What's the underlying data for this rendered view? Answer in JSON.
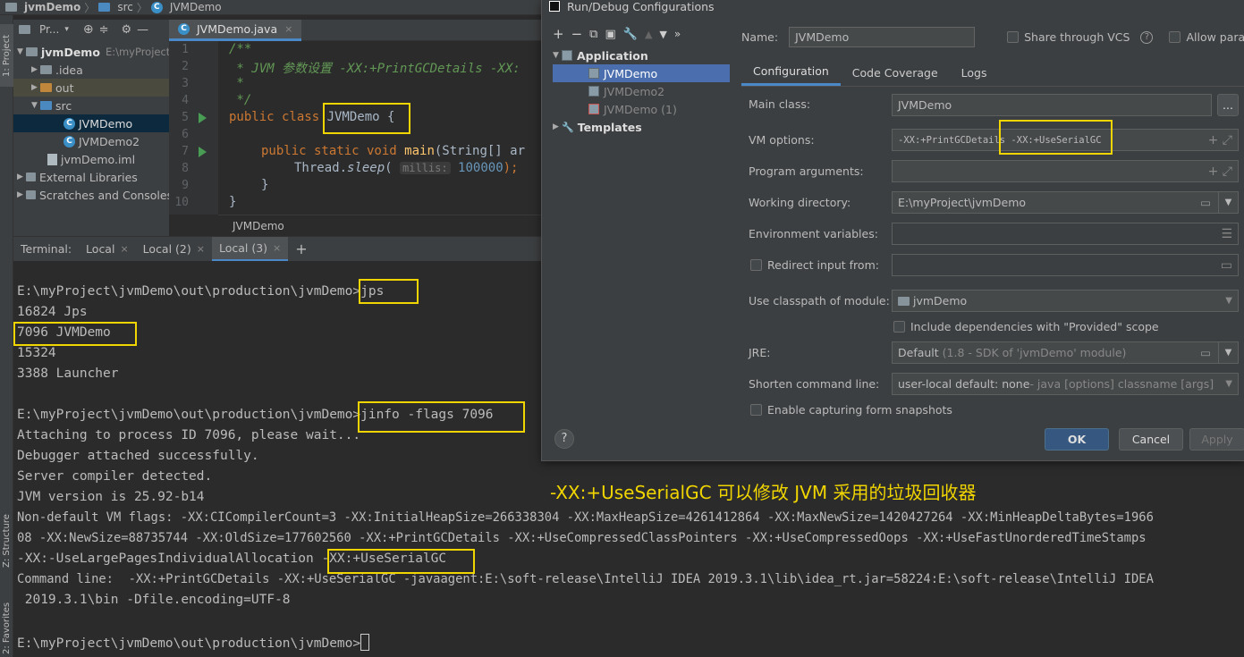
{
  "breadcrumb": [
    "jvmDemo",
    "src",
    "JVMDemo"
  ],
  "left_strip": {
    "project_tab": "1: Project",
    "structure_tab": "Z: Structure",
    "favorites_tab": "2: Favorites"
  },
  "project": {
    "header_label": "Pr...",
    "tree": [
      {
        "label": "jvmDemo",
        "extra": "E:\\myProject\\jvmDemo"
      },
      {
        "label": ".idea"
      },
      {
        "label": "out"
      },
      {
        "label": "src"
      },
      {
        "label": "JVMDemo"
      },
      {
        "label": "JVMDemo2"
      },
      {
        "label": "jvmDemo.iml"
      },
      {
        "label": "External Libraries"
      },
      {
        "label": "Scratches and Consoles"
      }
    ]
  },
  "editor": {
    "tab_label": "JVMDemo.java",
    "line_numbers": [
      "1",
      "2",
      "3",
      "4",
      "5",
      "6",
      "7",
      "8",
      "9",
      "10"
    ],
    "lines": {
      "l1": "/**",
      "l2": " * JVM 参数设置 -XX:+PrintGCDetails -XX:",
      "l3": " *",
      "l4": " */",
      "l5_kw": "public class ",
      "l5_name": "JVMDemo",
      "l5_brace": " {",
      "l7_kw": "public static void ",
      "l7_fn": "main",
      "l7_rest": "(String[] ar",
      "l8_pre": "Thread.",
      "l8_method": "sleep",
      "l8_open": "( ",
      "l8_hint": "millis:",
      "l8_num": "100000",
      "l8_close": ");",
      "l9": "}",
      "l10": "}"
    },
    "status_label": "JVMDemo"
  },
  "terminal": {
    "tabs": [
      {
        "label": "Terminal:"
      },
      {
        "label": "Local"
      },
      {
        "label": "Local (2)"
      },
      {
        "label": "Local (3)"
      }
    ],
    "add_label": "+",
    "lines": [
      "E:\\myProject\\jvmDemo\\out\\production\\jvmDemo>jps",
      "16824 Jps",
      "7096 JVMDemo",
      "15324",
      "3388 Launcher",
      "",
      "E:\\myProject\\jvmDemo\\out\\production\\jvmDemo>jinfo -flags 7096",
      "Attaching to process ID 7096, please wait...",
      "Debugger attached successfully.",
      "Server compiler detected.",
      "JVM version is 25.92-b14",
      "Non-default VM flags: -XX:CICompilerCount=3 -XX:InitialHeapSize=266338304 -XX:MaxHeapSize=4261412864 -XX:MaxNewSize=1420427264 -XX:MinHeapDeltaBytes=1966",
      "08 -XX:NewSize=88735744 -XX:OldSize=177602560 -XX:+PrintGCDetails -XX:+UseCompressedClassPointers -XX:+UseCompressedOops -XX:+UseFastUnorderedTimeStamps",
      "-XX:-UseLargePagesIndividualAllocation -XX:+UseSerialGC",
      "Command line:  -XX:+PrintGCDetails -XX:+UseSerialGC -javaagent:E:\\soft-release\\IntelliJ IDEA 2019.3.1\\lib\\idea_rt.jar=58224:E:\\soft-release\\IntelliJ IDEA",
      " 2019.3.1\\bin -Dfile.encoding=UTF-8",
      "",
      "E:\\myProject\\jvmDemo\\out\\production\\jvmDemo>"
    ]
  },
  "annotation": "-XX:+UseSerialGC  可以修改 JVM 采用的垃圾回收器",
  "dialog": {
    "title": "Run/Debug Configurations",
    "tree": {
      "application": "Application",
      "items": [
        "JVMDemo",
        "JVMDemo2",
        "JVMDemo (1)"
      ],
      "templates": "Templates"
    },
    "name_label": "Name:",
    "name_value": "JVMDemo",
    "share_vcs": "Share through VCS",
    "allow_parallel": "Allow parallel",
    "tabs": [
      "Configuration",
      "Code Coverage",
      "Logs"
    ],
    "fields": {
      "main_class_label": "Main class:",
      "main_class_value": "JVMDemo",
      "main_class_btn": "...",
      "vm_options_label": "VM options:",
      "vm_options_value": "-XX:+PrintGCDetails -XX:+UseSerialGC",
      "program_args_label": "Program arguments:",
      "working_dir_label": "Working directory:",
      "working_dir_value": "E:\\myProject\\jvmDemo",
      "env_vars_label": "Environment variables:",
      "redirect_label": "Redirect input from:",
      "classpath_label": "Use classpath of module:",
      "classpath_value": "jvmDemo",
      "include_deps": "Include dependencies with \"Provided\" scope",
      "jre_label": "JRE:",
      "jre_value": "Default",
      "jre_detail": "(1.8 - SDK of 'jvmDemo' module)",
      "shorten_label": "Shorten command line:",
      "shorten_value": "user-local default: none",
      "shorten_detail": " - java [options] classname [args]",
      "capture_snapshots": "Enable capturing form snapshots"
    },
    "buttons": {
      "help": "?",
      "ok": "OK",
      "cancel": "Cancel",
      "apply": "Apply"
    }
  },
  "colors": {
    "highlight": "#f1d500",
    "accent": "#4a88c7",
    "selection": "#4b6eaf"
  }
}
